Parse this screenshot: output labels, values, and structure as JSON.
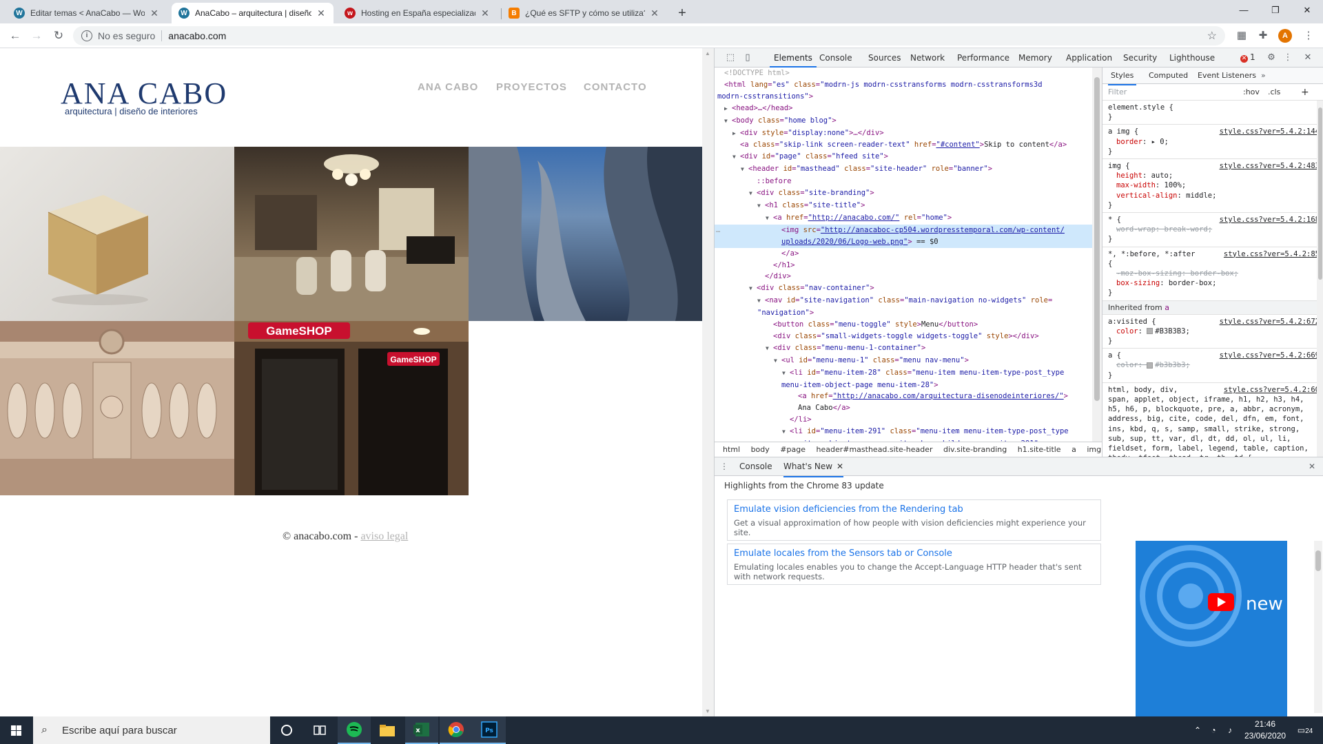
{
  "browser": {
    "tabs": [
      {
        "title": "Editar temas < AnaCabo — WordPress",
        "favicon": "wordpress-icon",
        "color": "#21759b",
        "active": false
      },
      {
        "title": "AnaCabo – arquitectura | diseño de interiores",
        "favicon": "wordpress-icon",
        "color": "#21759b",
        "active": true
      },
      {
        "title": "Hosting en España especializado",
        "favicon": "webempresa-icon",
        "color": "#c4161c",
        "active": false
      },
      {
        "title": "¿Qué es SFTP y cómo se utiliza?",
        "favicon": "blogger-icon",
        "color": "#f57d00",
        "active": false
      }
    ],
    "new_tab": "+",
    "window_controls": {
      "minimize": "—",
      "restore": "❐",
      "close": "✕"
    },
    "address": {
      "security": "No es seguro",
      "url": "anacabo.com"
    },
    "profile_initial": "A"
  },
  "site": {
    "logo_title": "ANA CABO",
    "logo_tagline": "arquitectura | diseño de interiores",
    "nav": [
      "ANA CABO",
      "PROYECTOS",
      "CONTACTO"
    ],
    "tiles": [
      {
        "name": "wood-cube-render"
      },
      {
        "name": "interior-lounge-photo"
      },
      {
        "name": "abstract-blue-render"
      },
      {
        "name": "balustrade-photo"
      },
      {
        "name": "gameshop-storefront-photo",
        "sign": "GameSHOP"
      }
    ],
    "footer": {
      "copyright": "© anacabo.com -",
      "legal_link": "aviso legal"
    }
  },
  "devtools": {
    "tabs": [
      "Elements",
      "Console",
      "Sources",
      "Network",
      "Performance",
      "Memory",
      "Application",
      "Security",
      "Lighthouse"
    ],
    "active_tab": "Elements",
    "error_count": "1",
    "breadcrumbs": [
      "html",
      "body",
      "#page",
      "header#masthead.site-header",
      "div.site-branding",
      "h1.site-title",
      "a",
      "img"
    ],
    "styles_tabs": [
      "Styles",
      "Computed",
      "Event Listeners"
    ],
    "filter_placeholder": "Filter",
    "filter_hov": ":hov",
    "filter_cls": ".cls",
    "inherited_label": "Inherited from",
    "inherited_from": "a",
    "drawer_tabs": [
      "Console",
      "What's New"
    ],
    "drawer_heading": "Highlights from the Chrome 83 update",
    "cards": [
      {
        "title": "Emulate vision deficiencies from the Rendering tab",
        "desc": "Get a visual approximation of how people with vision deficiencies might experience your site."
      },
      {
        "title": "Emulate locales from the Sensors tab or Console",
        "desc": "Emulating locales enables you to change the Accept-Language HTTP header that's sent with network requests."
      }
    ],
    "video_label": "new"
  },
  "taskbar": {
    "search_placeholder": "Escribe aquí para buscar",
    "time": "21:46",
    "date": "23/06/2020",
    "notification_count": "24",
    "apps": [
      "cortana-icon",
      "task-view-icon",
      "spotify-icon",
      "file-explorer-icon",
      "excel-icon",
      "chrome-icon",
      "photoshop-icon"
    ]
  }
}
